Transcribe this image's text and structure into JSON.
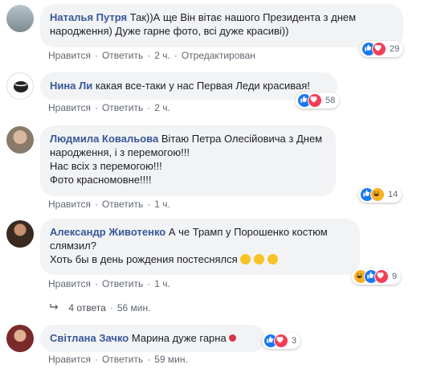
{
  "comments": [
    {
      "author": "Наталья Путря",
      "text_lines": [
        "Так))А ще Він вітає нашого Президента з днем",
        "народження) Дуже гарне фото, всі дуже красиві))"
      ],
      "like_label": "Нравится",
      "reply_label": "Ответить",
      "time": "2 ч.",
      "edited": "Отредактирован",
      "reactions": [
        "like-icon",
        "love-icon"
      ],
      "reaction_count": "29"
    },
    {
      "author": "Нина Ли",
      "text_lines": [
        "какая все-таки у нас Первая Леди красивая!"
      ],
      "like_label": "Нравится",
      "reply_label": "Ответить",
      "time": "2 ч.",
      "reactions": [
        "like-icon",
        "love-icon"
      ],
      "reaction_count": "58"
    },
    {
      "author": "Людмила Ковальова",
      "text_lines": [
        "Вітаю Петра Олесійовича з Днем",
        "народження, і з перемогою!!!",
        "Нас всіх з перемогою!!!",
        "Фото красномовне!!!!"
      ],
      "like_label": "Нравится",
      "reply_label": "Ответить",
      "time": "1 ч.",
      "reactions": [
        "like-icon",
        "haha-icon"
      ],
      "reaction_count": "14"
    },
    {
      "author": "Александр Животенко",
      "text_lines": [
        "А че Трамп у Порошенко костюм",
        "слямзил?",
        "Хоть бы в день рождения постеснялся"
      ],
      "like_label": "Нравится",
      "reply_label": "Ответить",
      "time": "1 ч.",
      "reactions": [
        "haha-icon",
        "like-icon",
        "love-icon"
      ],
      "reaction_count": "9"
    },
    {
      "author": "Світлана Зачко",
      "text_lines": [
        "Марина дуже гарна"
      ],
      "like_label": "Нравится",
      "reply_label": "Ответить",
      "time": "59 мин.",
      "reactions": [
        "like-icon",
        "love-icon"
      ],
      "reaction_count": "3"
    }
  ],
  "replies_link": {
    "label": "4 ответа",
    "time": "56 мин."
  },
  "colors": {
    "author": "#385898",
    "bubble": "#f2f3f5",
    "like": "#1877f2",
    "love": "#f33e58",
    "haha": "#f7b125"
  }
}
